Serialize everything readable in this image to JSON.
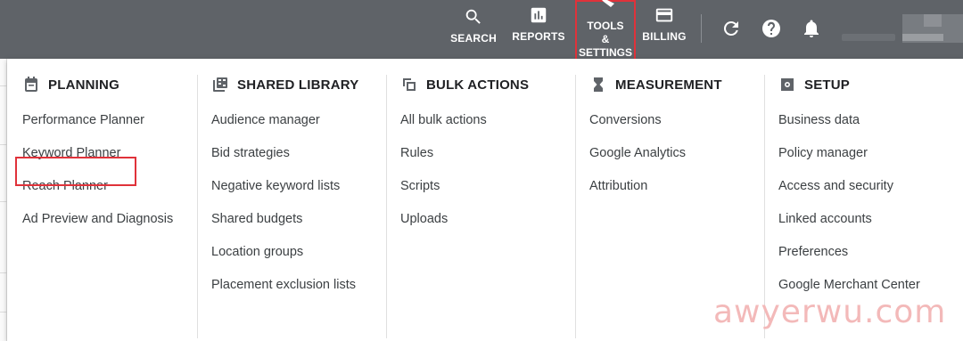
{
  "topbar": {
    "search": {
      "label": "SEARCH",
      "icon": "search-icon"
    },
    "reports": {
      "label": "REPORTS",
      "icon": "bar-chart-icon"
    },
    "tools": {
      "line1": "TOOLS",
      "line2": "&",
      "line3": "SETTINGS",
      "icon": "wrench-icon"
    },
    "billing": {
      "label": "BILLING",
      "icon": "credit-card-icon"
    },
    "refresh": {
      "icon": "refresh-icon"
    },
    "help": {
      "icon": "help-icon"
    },
    "notifications": {
      "icon": "bell-icon"
    }
  },
  "menu": {
    "columns": [
      {
        "title": "PLANNING",
        "icon": "calendar-icon",
        "items": [
          "Performance Planner",
          "Keyword Planner",
          "Reach Planner",
          "Ad Preview and Diagnosis"
        ]
      },
      {
        "title": "SHARED LIBRARY",
        "icon": "library-icon",
        "items": [
          "Audience manager",
          "Bid strategies",
          "Negative keyword lists",
          "Shared budgets",
          "Location groups",
          "Placement exclusion lists"
        ]
      },
      {
        "title": "BULK ACTIONS",
        "icon": "copy-icon",
        "items": [
          "All bulk actions",
          "Rules",
          "Scripts",
          "Uploads"
        ]
      },
      {
        "title": "MEASUREMENT",
        "icon": "hourglass-icon",
        "items": [
          "Conversions",
          "Google Analytics",
          "Attribution"
        ]
      },
      {
        "title": "SETUP",
        "icon": "gear-box-icon",
        "items": [
          "Business data",
          "Policy manager",
          "Access and security",
          "Linked accounts",
          "Preferences",
          "Google Merchant Center"
        ]
      }
    ]
  },
  "watermark": "awyerwu.com",
  "colors": {
    "topbar": "#5f6368",
    "highlight": "#e0323a",
    "watermark": "#f3b9b9"
  }
}
